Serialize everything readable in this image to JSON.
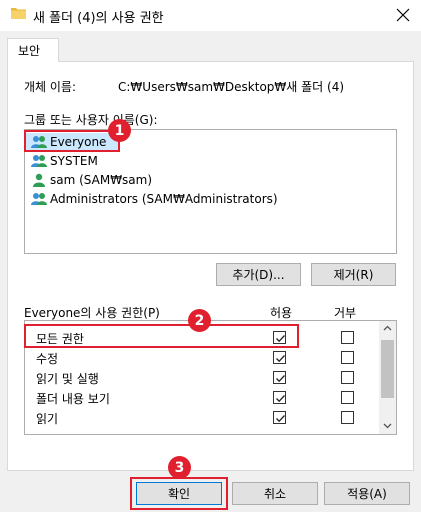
{
  "window": {
    "title": "새 폴더 (4)의 사용 권한"
  },
  "tabs": [
    {
      "label": "보안"
    }
  ],
  "object": {
    "label": "개체 이름:",
    "value": "C:₩Users₩sam₩Desktop₩새 폴더 (4)"
  },
  "group_list": {
    "label": "그룹 또는 사용자 이름(G):",
    "items": [
      {
        "name": "Everyone",
        "icon": "group-users-icon"
      },
      {
        "name": "SYSTEM",
        "icon": "group-users-icon"
      },
      {
        "name": "sam (SAM₩sam)",
        "icon": "user-icon"
      },
      {
        "name": "Administrators (SAM₩Administrators)",
        "icon": "group-users-icon"
      }
    ]
  },
  "buttons": {
    "add": "추가(D)...",
    "remove": "제거(R)",
    "ok": "확인",
    "cancel": "취소",
    "apply": "적용(A)"
  },
  "permissions": {
    "label": "Everyone의 사용 권한(P)",
    "allow_header": "허용",
    "deny_header": "거부",
    "rows": [
      {
        "name": "모든 권한",
        "allow": true,
        "deny": false
      },
      {
        "name": "수정",
        "allow": true,
        "deny": false
      },
      {
        "name": "읽기 및 실행",
        "allow": true,
        "deny": false
      },
      {
        "name": "폴더 내용 보기",
        "allow": true,
        "deny": false
      },
      {
        "name": "읽기",
        "allow": true,
        "deny": false
      }
    ]
  },
  "annotations": [
    {
      "number": "1"
    },
    {
      "number": "2"
    },
    {
      "number": "3"
    }
  ],
  "colors": {
    "highlight": "#e0202e",
    "selection": "#cce8ff"
  }
}
